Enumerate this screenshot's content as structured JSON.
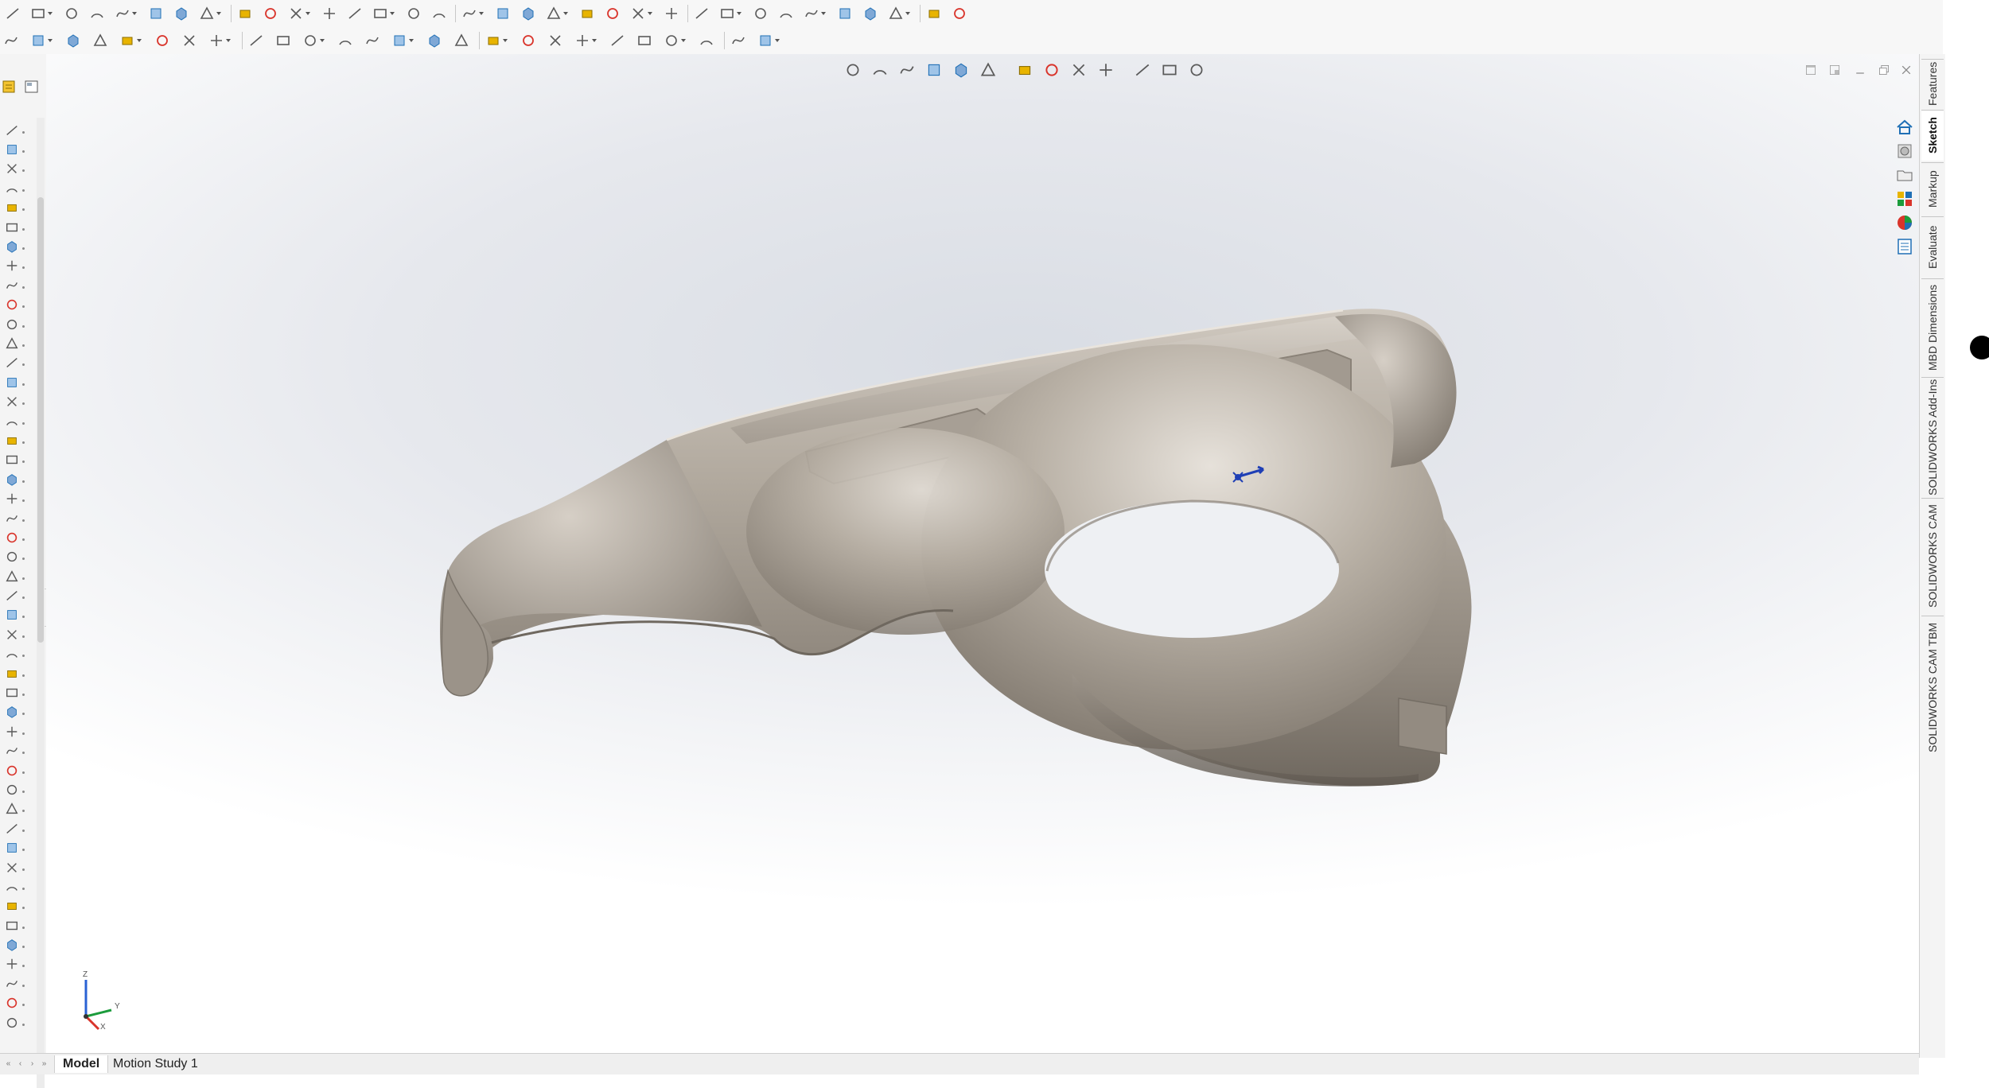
{
  "toolbar": {
    "row1_icons": [
      "sketch-line-dropdown-icon",
      "line-icon",
      "rectangle-icon",
      "slot-icon",
      "circle-icon",
      "arc-icon",
      "spline-icon",
      "ellipse-icon",
      "fillet-sketch-icon",
      "polygon-icon",
      "point-icon",
      "plane-icon",
      "text-icon",
      "trim-icon",
      "convert-entities-icon",
      "offset-icon",
      "mirror-icon",
      "linear-pattern-icon",
      "move-entities-icon",
      "display-relations-icon",
      "repair-sketch-icon",
      "quick-snaps-icon",
      "rapid-sketch-icon",
      "instant2d-icon",
      "reference-geometry-icon",
      "view-front-icon",
      "view-back-icon",
      "view-left-icon",
      "view-right-icon",
      "view-top-icon",
      "view-bottom-icon",
      "view-iso-icon",
      "view-normal-icon",
      "edit-appearance-icon"
    ],
    "row2_icons": [
      "smart-dimension-icon",
      "rebuild-icon",
      "extrude-boss-icon",
      "revolve-icon",
      "sweep-icon",
      "equations-icon",
      "measure-icon",
      "mass-properties-icon",
      "section-properties-icon",
      "check-icon",
      "tolerance-icon",
      "interference-icon",
      "draft-analysis-icon",
      "curvature-icon",
      "zebra-icon",
      "thickness-icon",
      "shaded-icon",
      "hidden-lines-icon",
      "wireframe-icon",
      "section-view-icon",
      "display-style-icon",
      "hide-show-icon",
      "instant3d-icon",
      "sketch-relations-icon",
      "curve-tools-icon",
      "selection-filter-icon"
    ]
  },
  "heads_up": {
    "icons": [
      "zoom-to-fit-icon",
      "zoom-area-icon",
      "previous-view-icon",
      "section-view-icon",
      "dynamic-annotation-icon",
      "view-orientation-icon",
      "display-style-icon",
      "hide-show-items-icon",
      "edit-appearance-icon",
      "apply-scene-icon",
      "view-settings-icon",
      "render-tools-icon",
      "realview-icon"
    ]
  },
  "tree_panel": {
    "tabs": [
      "feature-manager-tab-icon",
      "property-manager-tab-icon"
    ],
    "item_count": 47
  },
  "viewport": {
    "window_controls": [
      "restore-icon",
      "tile-icon",
      "minimize-icon",
      "maximize-icon",
      "close-icon"
    ],
    "triad_axes": {
      "z": "Z",
      "y": "Y",
      "x": "X"
    },
    "part_color": "#aca49b"
  },
  "task_pane": {
    "icons": [
      "home-icon",
      "design-library-icon",
      "file-explorer-icon",
      "view-palette-icon",
      "appearances-icon",
      "custom-properties-icon"
    ],
    "tabs": [
      "Features",
      "Sketch",
      "Markup",
      "Evaluate",
      "MBD Dimensions",
      "SOLIDWORKS Add-Ins",
      "SOLIDWORKS CAM",
      "SOLIDWORKS CAM TBM"
    ],
    "active_tab": "Sketch"
  },
  "bottom_tabs": {
    "model": "Model",
    "motion_study": "Motion Study 1"
  },
  "colors": {
    "accent_blue": "#1f6fb5",
    "icon_gray": "#5a5a5a",
    "yellow": "#e8b400",
    "red": "#d9342b"
  }
}
